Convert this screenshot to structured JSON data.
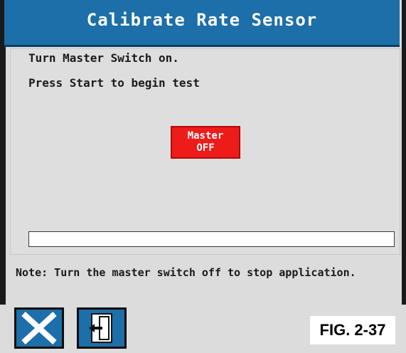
{
  "title": "Calibrate Rate Sensor",
  "instructions": {
    "line1": "Turn Master Switch on.",
    "line2": "Press Start to begin test"
  },
  "master_button": {
    "line1": "Master",
    "line2": "OFF",
    "color": "#ee1b1b"
  },
  "progress": {
    "fraction": 0
  },
  "note": "Note: Turn the master switch off to stop application.",
  "buttons": {
    "cancel_icon": "close-x-icon",
    "exit_icon": "exit-door-icon"
  },
  "figure_label": "FIG. 2-37",
  "colors": {
    "accent": "#1c6fa8",
    "background": "#dcdcdc"
  }
}
